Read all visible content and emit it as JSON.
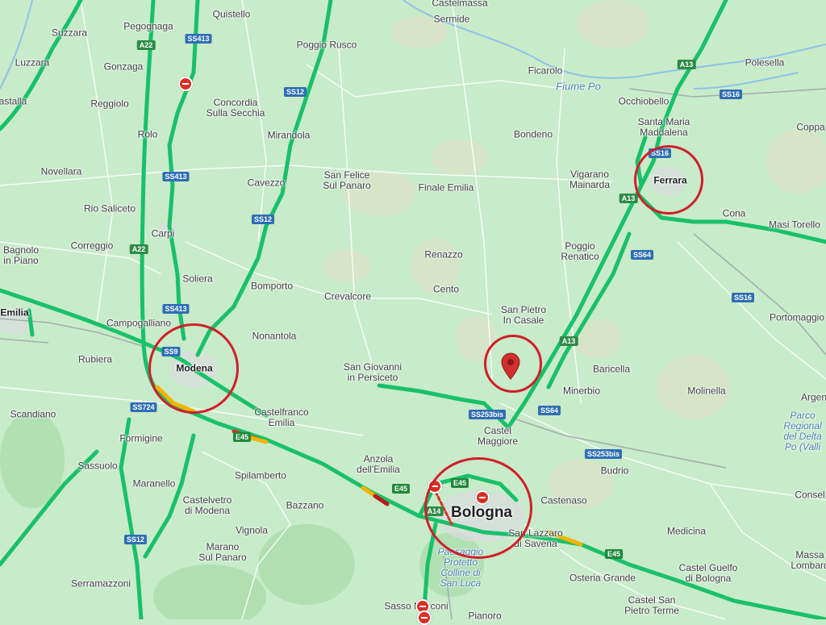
{
  "places": [
    {
      "name": "Castelmassa",
      "cls": ""
    },
    {
      "name": "Sermide",
      "cls": ""
    },
    {
      "name": "Quistello",
      "cls": ""
    },
    {
      "name": "Suzzara",
      "cls": ""
    },
    {
      "name": "Pegognaga",
      "cls": ""
    },
    {
      "name": "Poggio Rusco",
      "cls": ""
    },
    {
      "name": "Luzzara",
      "cls": ""
    },
    {
      "name": "Gonzaga",
      "cls": ""
    },
    {
      "name": "Ficarolo",
      "cls": ""
    },
    {
      "name": "Polesella",
      "cls": ""
    },
    {
      "name": "astalla",
      "cls": ""
    },
    {
      "name": "Reggiolo",
      "cls": ""
    },
    {
      "name": "Concordia\nSulla Secchia",
      "cls": ""
    },
    {
      "name": "Occhiobello",
      "cls": ""
    },
    {
      "name": "Santa Maria\nMaddalena",
      "cls": ""
    },
    {
      "name": "Coppa",
      "cls": ""
    },
    {
      "name": "Rolo",
      "cls": ""
    },
    {
      "name": "Mirandola",
      "cls": ""
    },
    {
      "name": "Bondeno",
      "cls": ""
    },
    {
      "name": "Novellara",
      "cls": ""
    },
    {
      "name": "San Felice\nSul Panaro",
      "cls": ""
    },
    {
      "name": "Cavezzo",
      "cls": ""
    },
    {
      "name": "Finale Emilia",
      "cls": ""
    },
    {
      "name": "Vigarano\nMainarda",
      "cls": ""
    },
    {
      "name": "Ferrara",
      "cls": "city"
    },
    {
      "name": "Rio Saliceto",
      "cls": ""
    },
    {
      "name": "Cona",
      "cls": ""
    },
    {
      "name": "Masi Torello",
      "cls": ""
    },
    {
      "name": "Carpi",
      "cls": ""
    },
    {
      "name": "Correggio",
      "cls": ""
    },
    {
      "name": "Bagnolo\nin Piano",
      "cls": ""
    },
    {
      "name": "Renazzo",
      "cls": ""
    },
    {
      "name": "Poggio\nRenatico",
      "cls": ""
    },
    {
      "name": "Soliera",
      "cls": ""
    },
    {
      "name": "Bomporto",
      "cls": ""
    },
    {
      "name": "Cento",
      "cls": ""
    },
    {
      "name": "Crevalcore",
      "cls": ""
    },
    {
      "name": "Emilia",
      "cls": "city"
    },
    {
      "name": "Campogalliano",
      "cls": ""
    },
    {
      "name": "San Pietro\nIn Casale",
      "cls": ""
    },
    {
      "name": "Portomaggio",
      "cls": ""
    },
    {
      "name": "Nonantola",
      "cls": ""
    },
    {
      "name": "Rubiera",
      "cls": ""
    },
    {
      "name": "Modena",
      "cls": "city"
    },
    {
      "name": "San Giovanni\nin Persiceto",
      "cls": ""
    },
    {
      "name": "Baricella",
      "cls": ""
    },
    {
      "name": "Molinella",
      "cls": ""
    },
    {
      "name": "Minerbio",
      "cls": ""
    },
    {
      "name": "Argen",
      "cls": ""
    },
    {
      "name": "Scandiano",
      "cls": ""
    },
    {
      "name": "Castelfranco\nEmilia",
      "cls": ""
    },
    {
      "name": "Parco\nRegional\ndel Delta\nPo (Valli",
      "cls": "water"
    },
    {
      "name": "Formigine",
      "cls": ""
    },
    {
      "name": "Castel\nMaggiore",
      "cls": ""
    },
    {
      "name": "Sassuolo",
      "cls": ""
    },
    {
      "name": "Budrio",
      "cls": ""
    },
    {
      "name": "Anzola\ndell'Emilia",
      "cls": ""
    },
    {
      "name": "Maranello",
      "cls": ""
    },
    {
      "name": "Spilamberto",
      "cls": ""
    },
    {
      "name": "Consel",
      "cls": ""
    },
    {
      "name": "Castelvetro\ndi Modena",
      "cls": ""
    },
    {
      "name": "Castenaso",
      "cls": ""
    },
    {
      "name": "Bazzano",
      "cls": ""
    },
    {
      "name": "Bologna",
      "cls": "city big"
    },
    {
      "name": "Vignola",
      "cls": ""
    },
    {
      "name": "Medicina",
      "cls": ""
    },
    {
      "name": "San Lazzaro\ndi Savena",
      "cls": ""
    },
    {
      "name": "Marano\nSul Panaro",
      "cls": ""
    },
    {
      "name": "Paesaggio\nProtetto\nColline di\nSan Luca",
      "cls": "water"
    },
    {
      "name": "Massa\nLombard",
      "cls": ""
    },
    {
      "name": "Castel Guelfo\ndi Bologna",
      "cls": ""
    },
    {
      "name": "Osteria Grande",
      "cls": ""
    },
    {
      "name": "Serramazzoni",
      "cls": ""
    },
    {
      "name": "Castel San\nPietro Terme",
      "cls": ""
    },
    {
      "name": "Sasso Marconi",
      "cls": ""
    },
    {
      "name": "Pianoro",
      "cls": ""
    },
    {
      "name": "Fiume Po",
      "cls": "water"
    }
  ],
  "road_labels": [
    {
      "text": "A22",
      "style": "green"
    },
    {
      "text": "SS413",
      "style": "blue"
    },
    {
      "text": "SS12",
      "style": "blue"
    },
    {
      "text": "SS413",
      "style": "blue"
    },
    {
      "text": "SS12",
      "style": "blue"
    },
    {
      "text": "A22",
      "style": "green"
    },
    {
      "text": "SS413",
      "style": "blue"
    },
    {
      "text": "SS9",
      "style": "blue"
    },
    {
      "text": "SS724",
      "style": "blue"
    },
    {
      "text": "E45",
      "style": "eu"
    },
    {
      "text": "E45",
      "style": "eu"
    },
    {
      "text": "E45",
      "style": "eu"
    },
    {
      "text": "A14",
      "style": "green"
    },
    {
      "text": "SS12",
      "style": "blue"
    },
    {
      "text": "SS253bis",
      "style": "blue"
    },
    {
      "text": "SS253bis",
      "style": "blue"
    },
    {
      "text": "SS64",
      "style": "blue"
    },
    {
      "text": "A13",
      "style": "green"
    },
    {
      "text": "SS64",
      "style": "blue"
    },
    {
      "text": "A13",
      "style": "green"
    },
    {
      "text": "SS16",
      "style": "blue"
    },
    {
      "text": "SS16",
      "style": "blue"
    },
    {
      "text": "A13",
      "style": "green"
    },
    {
      "text": "SS16",
      "style": "blue"
    },
    {
      "text": "E45",
      "style": "eu"
    }
  ],
  "markers": {
    "pin": "location-pin",
    "circled_places": [
      "Modena",
      "Ferrara",
      "Bologna",
      "location-pin"
    ],
    "closures": 5
  },
  "colors": {
    "land": "#c8ebc9",
    "highway": "#19c06a",
    "highlight_circle": "#d01f2a",
    "pin": "#d32f2f"
  }
}
